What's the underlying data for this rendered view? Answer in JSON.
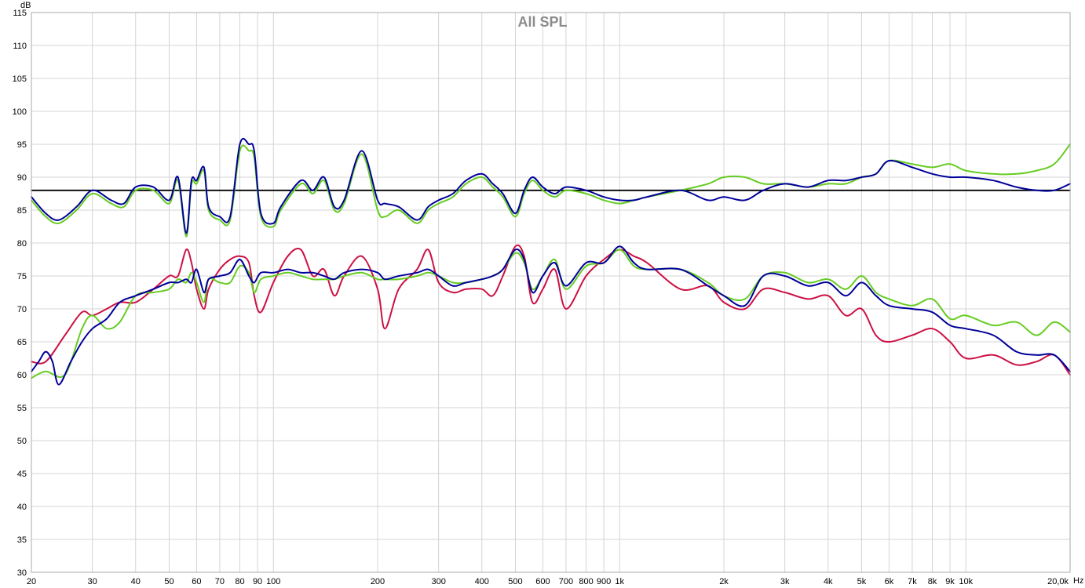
{
  "chart_data": {
    "type": "line",
    "title": "All SPL",
    "ylabel": "dB",
    "xlabel": "Hz",
    "x_scale": "log",
    "xlim": [
      20,
      20000
    ],
    "ylim": [
      30,
      115
    ],
    "grid": true,
    "y_ticks": [
      30,
      35,
      40,
      45,
      50,
      55,
      60,
      65,
      70,
      75,
      80,
      85,
      90,
      95,
      100,
      105,
      110,
      115
    ],
    "x_ticks": [
      {
        "v": 20,
        "label": "20"
      },
      {
        "v": 30,
        "label": "30"
      },
      {
        "v": 40,
        "label": "40"
      },
      {
        "v": 50,
        "label": "50"
      },
      {
        "v": 60,
        "label": "60"
      },
      {
        "v": 70,
        "label": "70"
      },
      {
        "v": 80,
        "label": "80"
      },
      {
        "v": 90,
        "label": "90"
      },
      {
        "v": 100,
        "label": "100"
      },
      {
        "v": 200,
        "label": "200"
      },
      {
        "v": 300,
        "label": "300"
      },
      {
        "v": 400,
        "label": "400"
      },
      {
        "v": 500,
        "label": "500"
      },
      {
        "v": 600,
        "label": "600"
      },
      {
        "v": 700,
        "label": "700"
      },
      {
        "v": 800,
        "label": "800"
      },
      {
        "v": 900,
        "label": "900"
      },
      {
        "v": 1000,
        "label": "1k"
      },
      {
        "v": 2000,
        "label": "2k"
      },
      {
        "v": 3000,
        "label": "3k"
      },
      {
        "v": 4000,
        "label": "4k"
      },
      {
        "v": 5000,
        "label": "5k"
      },
      {
        "v": 6000,
        "label": "6k"
      },
      {
        "v": 7000,
        "label": "7k"
      },
      {
        "v": 8000,
        "label": "8k"
      },
      {
        "v": 9000,
        "label": "9k"
      },
      {
        "v": 10000,
        "label": "10k"
      },
      {
        "v": 20000,
        "label": "20,0k"
      }
    ],
    "series": [
      {
        "color": "#000000",
        "x": [
          20,
          20000
        ],
        "y": [
          88,
          88
        ]
      },
      {
        "color": "#66cc22",
        "x": [
          20,
          22,
          24,
          27,
          30,
          34,
          37,
          40,
          45,
          50,
          53,
          56,
          58,
          60,
          63,
          65,
          70,
          75,
          80,
          85,
          88,
          92,
          100,
          105,
          120,
          130,
          140,
          150,
          160,
          180,
          200,
          210,
          230,
          260,
          280,
          300,
          330,
          360,
          400,
          430,
          460,
          500,
          530,
          560,
          600,
          650,
          700,
          800,
          900,
          1000,
          1100,
          1200,
          1500,
          1800,
          2000,
          2300,
          2600,
          3000,
          3500,
          4000,
          4500,
          5000,
          5500,
          6000,
          7000,
          8000,
          9000,
          10000,
          12000,
          14000,
          16000,
          18000,
          20000
        ],
        "y": [
          86.5,
          84,
          83,
          85,
          87.5,
          86,
          85.5,
          88,
          88,
          86,
          89.5,
          81,
          89,
          89,
          91,
          85,
          83.5,
          83.5,
          94,
          94,
          93,
          84,
          82.5,
          85,
          89,
          87.5,
          89.5,
          85,
          86,
          93.5,
          85,
          84,
          85,
          83,
          85,
          86,
          87,
          89,
          90,
          88.5,
          87,
          84,
          87.5,
          89.5,
          88,
          87,
          88,
          87.5,
          86.5,
          86,
          86.5,
          87,
          88,
          89,
          90,
          90,
          89,
          89,
          88.5,
          89,
          89,
          90,
          90.5,
          92.5,
          92,
          91.5,
          92,
          91,
          90.5,
          90.5,
          91,
          92,
          95
        ]
      },
      {
        "color": "#000099",
        "x": [
          20,
          22,
          24,
          27,
          30,
          34,
          37,
          40,
          45,
          50,
          53,
          56,
          58,
          60,
          63,
          65,
          70,
          75,
          80,
          85,
          88,
          92,
          100,
          105,
          120,
          130,
          140,
          150,
          160,
          180,
          200,
          210,
          230,
          260,
          280,
          300,
          330,
          360,
          400,
          430,
          460,
          500,
          530,
          560,
          600,
          650,
          700,
          800,
          900,
          1000,
          1100,
          1200,
          1500,
          1800,
          2000,
          2300,
          2600,
          3000,
          3500,
          4000,
          4500,
          5000,
          5500,
          6000,
          7000,
          8000,
          9000,
          10000,
          12000,
          14000,
          16000,
          18000,
          20000
        ],
        "y": [
          87,
          84.5,
          83.5,
          85.5,
          88,
          86.5,
          86,
          88.5,
          88.5,
          86.5,
          90,
          81.5,
          89.5,
          89.5,
          91.5,
          85.5,
          84,
          84,
          95,
          95,
          94,
          84.5,
          83,
          85.5,
          89.5,
          88,
          90,
          85.5,
          86.5,
          94,
          86.5,
          86,
          85.5,
          83.5,
          85.5,
          86.5,
          87.5,
          89.5,
          90.5,
          89,
          87.5,
          84.5,
          88,
          90,
          88.5,
          87.5,
          88.5,
          88,
          87,
          86.5,
          86.5,
          87,
          88,
          86.5,
          87,
          86.5,
          88,
          89,
          88.5,
          89.5,
          89.5,
          90,
          90.5,
          92.5,
          91.5,
          90.5,
          90,
          90,
          89.5,
          88.5,
          88,
          88,
          89
        ]
      },
      {
        "color": "#cc1144",
        "x": [
          20,
          22,
          25,
          28,
          30,
          33,
          36,
          40,
          45,
          50,
          53,
          56,
          58,
          60,
          63,
          65,
          70,
          75,
          80,
          85,
          88,
          92,
          100,
          110,
          120,
          130,
          140,
          150,
          160,
          180,
          200,
          210,
          230,
          260,
          280,
          300,
          330,
          360,
          400,
          430,
          460,
          500,
          530,
          560,
          600,
          650,
          700,
          800,
          900,
          1000,
          1100,
          1200,
          1500,
          1800,
          2000,
          2300,
          2600,
          3000,
          3500,
          4000,
          4500,
          5000,
          5500,
          6000,
          7000,
          8000,
          9000,
          10000,
          12000,
          14000,
          16000,
          18000,
          20000
        ],
        "y": [
          62,
          62,
          66,
          69.5,
          69,
          70,
          71,
          71,
          73,
          75,
          75,
          79,
          77,
          73,
          70,
          73,
          76,
          77.5,
          78,
          77,
          72,
          69.5,
          74,
          78,
          79,
          75,
          76,
          72,
          75,
          78,
          73,
          67,
          73,
          76,
          79,
          74,
          72.5,
          73,
          73,
          72,
          75,
          79.5,
          78,
          71,
          73,
          76,
          70,
          75,
          77.5,
          79,
          78,
          77,
          73,
          73.5,
          71,
          70,
          73,
          72.5,
          71.5,
          72,
          69,
          70,
          66,
          65,
          66,
          67,
          65,
          62.5,
          63,
          61.5,
          62,
          63,
          60
        ]
      },
      {
        "color": "#66cc22",
        "x": [
          20,
          22,
          25,
          28,
          30,
          33,
          36,
          40,
          45,
          50,
          53,
          56,
          58,
          60,
          63,
          65,
          70,
          75,
          80,
          85,
          88,
          92,
          100,
          110,
          120,
          130,
          140,
          150,
          160,
          180,
          200,
          210,
          230,
          260,
          280,
          300,
          330,
          360,
          400,
          430,
          460,
          500,
          530,
          560,
          600,
          650,
          700,
          800,
          900,
          1000,
          1100,
          1200,
          1500,
          1800,
          2000,
          2300,
          2600,
          3000,
          3500,
          4000,
          4500,
          5000,
          5500,
          6000,
          7000,
          8000,
          9000,
          10000,
          12000,
          14000,
          16000,
          18000,
          20000
        ],
        "y": [
          59.5,
          60.5,
          60,
          67,
          69,
          67,
          68,
          72,
          72.5,
          73,
          74.5,
          74,
          75.5,
          74,
          71,
          74.5,
          74,
          74,
          76.5,
          75.5,
          72.5,
          74.5,
          75,
          75.5,
          75,
          74.5,
          74.5,
          74.5,
          75,
          75.5,
          74.5,
          74.5,
          74.5,
          75,
          75.5,
          75,
          74,
          74,
          74.5,
          75,
          76,
          78.5,
          77,
          73,
          75,
          77.5,
          73,
          76.5,
          77,
          79,
          76.5,
          76,
          76,
          74,
          72,
          71.5,
          75,
          75.5,
          74,
          74.5,
          73,
          75,
          72.5,
          71.5,
          70.5,
          71.5,
          68.5,
          69,
          67.5,
          68,
          66,
          68,
          66.5
        ]
      },
      {
        "color": "#000099",
        "x": [
          20,
          21,
          22,
          23,
          24,
          26,
          28,
          30,
          33,
          36,
          40,
          45,
          50,
          53,
          56,
          58,
          60,
          63,
          65,
          70,
          75,
          80,
          85,
          88,
          92,
          100,
          110,
          120,
          130,
          140,
          150,
          160,
          180,
          200,
          210,
          230,
          260,
          280,
          300,
          330,
          360,
          400,
          430,
          460,
          500,
          530,
          560,
          600,
          650,
          700,
          800,
          900,
          1000,
          1100,
          1200,
          1500,
          1800,
          2000,
          2300,
          2600,
          3000,
          3500,
          4000,
          4500,
          5000,
          5500,
          6000,
          7000,
          8000,
          9000,
          10000,
          12000,
          14000,
          16000,
          18000,
          20000
        ],
        "y": [
          60.5,
          62,
          63.5,
          62,
          58.5,
          62,
          65,
          67,
          68.5,
          71,
          72,
          73,
          74,
          74,
          74.5,
          74,
          76,
          72.5,
          74.5,
          75,
          75.5,
          77.5,
          75,
          74,
          75.5,
          75.5,
          76,
          75.5,
          75.5,
          75,
          74.5,
          75.5,
          76,
          75.5,
          74.5,
          75,
          75.5,
          76,
          75,
          73.5,
          74,
          74.5,
          75,
          76,
          79,
          77.5,
          72.5,
          75,
          77,
          73.5,
          77,
          77,
          79.5,
          77,
          76,
          76,
          73.5,
          72,
          70.5,
          75,
          75,
          73.5,
          74,
          72,
          74,
          72,
          70.5,
          70,
          69.5,
          67.5,
          67,
          66,
          63.5,
          63,
          63,
          60.5
        ]
      }
    ]
  }
}
